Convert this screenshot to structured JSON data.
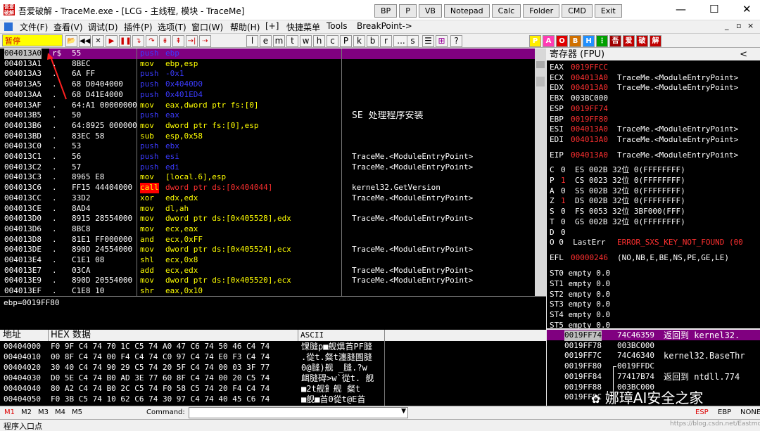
{
  "window": {
    "title": "吾爱破解 - TraceMe.exe - [LCG - 主线程, 模块 - TraceMe]",
    "icon_text": "吾爱破解",
    "quick_buttons": [
      "BP",
      "P",
      "VB",
      "Notepad",
      "Calc",
      "Folder",
      "CMD",
      "Exit"
    ]
  },
  "menu": [
    "文件(F)",
    "查看(V)",
    "调试(D)",
    "插件(P)",
    "选项(T)",
    "窗口(W)",
    "帮助(H)",
    "[+]",
    "快捷菜单",
    "Tools",
    "BreakPoint->"
  ],
  "toolbar": {
    "status": "暂停",
    "letters": [
      "l",
      "e",
      "m",
      "t",
      "w",
      "h",
      "c",
      "P",
      "k",
      "b",
      "r",
      "...",
      "s"
    ],
    "right_icons": [
      "P",
      "A",
      "O",
      "B",
      "H",
      "⋮",
      "吾",
      "爱",
      "破",
      "解"
    ]
  },
  "disasm": [
    {
      "addr": "004013A0",
      "mark": "r$",
      "hex": "55",
      "op": "push",
      "args": "ebp",
      "cmt": ""
    },
    {
      "addr": "004013A1",
      "mark": ".",
      "hex": "8BEC",
      "op": "mov",
      "args": "ebp,esp",
      "cmt": ""
    },
    {
      "addr": "004013A3",
      "mark": ".",
      "hex": "6A FF",
      "op": "push",
      "args": "-0x1",
      "cmt": ""
    },
    {
      "addr": "004013A5",
      "mark": ".",
      "hex": "68 D0404000",
      "op": "push",
      "args": "0x4040D0",
      "cmt": ""
    },
    {
      "addr": "004013AA",
      "mark": ".",
      "hex": "68 D41E4000",
      "op": "push",
      "args": "0x401ED4",
      "cmt": "SE 处理程序安装"
    },
    {
      "addr": "004013AF",
      "mark": ".",
      "hex": "64:A1 00000000",
      "op": "mov",
      "args": "eax,dword ptr fs:[0]",
      "cmt": ""
    },
    {
      "addr": "004013B5",
      "mark": ".",
      "hex": "50",
      "op": "push",
      "args": "eax",
      "cmt": ""
    },
    {
      "addr": "004013B6",
      "mark": ".",
      "hex": "64:8925 00000000",
      "op": "mov",
      "args": "dword ptr fs:[0],esp",
      "cmt": ""
    },
    {
      "addr": "004013BD",
      "mark": ".",
      "hex": "83EC 58",
      "op": "sub",
      "args": "esp,0x58",
      "cmt": ""
    },
    {
      "addr": "004013C0",
      "mark": ".",
      "hex": "53",
      "op": "push",
      "args": "ebx",
      "cmt": ""
    },
    {
      "addr": "004013C1",
      "mark": ".",
      "hex": "56",
      "op": "push",
      "args": "esi",
      "cmt": "TraceMe.<ModuleEntryPoint>"
    },
    {
      "addr": "004013C2",
      "mark": ".",
      "hex": "57",
      "op": "push",
      "args": "edi",
      "cmt": "TraceMe.<ModuleEntryPoint>"
    },
    {
      "addr": "004013C3",
      "mark": ".",
      "hex": "8965 E8",
      "op": "mov",
      "args": "[local.6],esp",
      "cmt": ""
    },
    {
      "addr": "004013C6",
      "mark": ".",
      "hex": "FF15 44404000",
      "op": "call",
      "args": "dword ptr ds:[0x404044]",
      "cmt": "kernel32.GetVersion"
    },
    {
      "addr": "004013CC",
      "mark": ".",
      "hex": "33D2",
      "op": "xor",
      "args": "edx,edx",
      "cmt": "TraceMe.<ModuleEntryPoint>"
    },
    {
      "addr": "004013CE",
      "mark": ".",
      "hex": "8AD4",
      "op": "mov",
      "args": "dl,ah",
      "cmt": ""
    },
    {
      "addr": "004013D0",
      "mark": ".",
      "hex": "8915 28554000",
      "op": "mov",
      "args": "dword ptr ds:[0x405528],edx",
      "cmt": "TraceMe.<ModuleEntryPoint>"
    },
    {
      "addr": "004013D6",
      "mark": ".",
      "hex": "8BC8",
      "op": "mov",
      "args": "ecx,eax",
      "cmt": ""
    },
    {
      "addr": "004013D8",
      "mark": ".",
      "hex": "81E1 FF000000",
      "op": "and",
      "args": "ecx,0xFF",
      "cmt": ""
    },
    {
      "addr": "004013DE",
      "mark": ".",
      "hex": "890D 24554000",
      "op": "mov",
      "args": "dword ptr ds:[0x405524],ecx",
      "cmt": "TraceMe.<ModuleEntryPoint>"
    },
    {
      "addr": "004013E4",
      "mark": ".",
      "hex": "C1E1 08",
      "op": "shl",
      "args": "ecx,0x8",
      "cmt": ""
    },
    {
      "addr": "004013E7",
      "mark": ".",
      "hex": "03CA",
      "op": "add",
      "args": "ecx,edx",
      "cmt": "TraceMe.<ModuleEntryPoint>"
    },
    {
      "addr": "004013E9",
      "mark": ".",
      "hex": "890D 20554000",
      "op": "mov",
      "args": "dword ptr ds:[0x405520],ecx",
      "cmt": "TraceMe.<ModuleEntryPoint>"
    },
    {
      "addr": "004013EF",
      "mark": ".",
      "hex": "C1E8 10",
      "op": "shr",
      "args": "eax,0x10",
      "cmt": ""
    }
  ],
  "info": "ebp=0019FF80",
  "registers": {
    "header": "寄存器 (FPU)",
    "gp": [
      {
        "name": "EAX",
        "val": "0019FFCC",
        "note": ""
      },
      {
        "name": "ECX",
        "val": "004013A0",
        "note": "TraceMe.<ModuleEntryPoint>"
      },
      {
        "name": "EDX",
        "val": "004013A0",
        "note": "TraceMe.<ModuleEntryPoint>"
      },
      {
        "name": "EBX",
        "val": "003BC000",
        "note": ""
      },
      {
        "name": "ESP",
        "val": "0019FF74",
        "note": ""
      },
      {
        "name": "EBP",
        "val": "0019FF80",
        "note": ""
      },
      {
        "name": "ESI",
        "val": "004013A0",
        "note": "TraceMe.<ModuleEntryPoint>"
      },
      {
        "name": "EDI",
        "val": "004013A0",
        "note": "TraceMe.<ModuleEntryPoint>"
      }
    ],
    "eip": {
      "name": "EIP",
      "val": "004013A0",
      "note": "TraceMe.<ModuleEntryPoint>"
    },
    "flags": [
      {
        "f": "C",
        "v": "0",
        "seg": "ES 002B 32位 0(FFFFFFFF)"
      },
      {
        "f": "P",
        "v": "1",
        "seg": "CS 0023 32位 0(FFFFFFFF)"
      },
      {
        "f": "A",
        "v": "0",
        "seg": "SS 002B 32位 0(FFFFFFFF)"
      },
      {
        "f": "Z",
        "v": "1",
        "seg": "DS 002B 32位 0(FFFFFFFF)"
      },
      {
        "f": "S",
        "v": "0",
        "seg": "FS 0053 32位 3BF000(FFF)"
      },
      {
        "f": "T",
        "v": "0",
        "seg": "GS 002B 32位 0(FFFFFFFF)"
      },
      {
        "f": "D",
        "v": "0",
        "seg": ""
      }
    ],
    "lasterr_label": "O 0  LastErr",
    "lasterr": "ERROR_SXS_KEY_NOT_FOUND (00",
    "efl_label": "EFL",
    "efl": "00000246",
    "efl_note": "(NO,NB,E,BE,NS,PE,GE,LE)",
    "fpu": [
      "ST0 empty 0.0",
      "ST1 empty 0.0",
      "ST2 empty 0.0",
      "ST3 empty 0.0",
      "ST4 empty 0.0",
      "ST5 empty 0.0"
    ]
  },
  "dump": {
    "col_addr": "地址",
    "col_hex": "HEX 数据",
    "col_ascii": "ASCII",
    "rows": [
      {
        "addr": "00404000",
        "hex": "F0 9F C4 74 70 1C C5 74 A0 47 C6 74 50 46 C4 74",
        "ascii": "馃膖p■舰熼苩PF膖"
      },
      {
        "addr": "00404010",
        "hex": "00 8F C4 74 00 F4 C4 74 C0 97 C4 74 E0 F3 C4 74",
        "ascii": ".從t.粲t瀍膖圄膖"
      },
      {
        "addr": "00404020",
        "hex": "30 40 C4 74 90 29 C5 74 20 5F C4 74 00 03 3F 77",
        "ascii": "0@膖)舰 _膖.?w"
      },
      {
        "addr": "00404030",
        "hex": "D0 5E C4 74 B0 AD 3E 77 60 8F C4 74 00 20 C5 74",
        "ascii": "衈膖碍>w`從t. 舰"
      },
      {
        "addr": "00404040",
        "hex": "80 A2 C4 74 B0 2C C5 74 F0 58 C5 74 20 F4 C4 74",
        "ascii": "■2t舰飠舰 粲t"
      },
      {
        "addr": "00404050",
        "hex": "F0 3B C5 74 10 62 C6 74 30 97 C4 74 40 45 C6 74",
        "ascii": "■舰■苩0從t@E苩"
      }
    ]
  },
  "stack": [
    {
      "addr": "0019FF74",
      "val": "74C46359",
      "note": "返回到 kernel32."
    },
    {
      "addr": "0019FF78",
      "val": "003BC000",
      "note": ""
    },
    {
      "addr": "0019FF7C",
      "val": "74C46340",
      "note": "kernel32.BaseThr"
    },
    {
      "addr": "0019FF80",
      "val": "0019FFDC",
      "note": ""
    },
    {
      "addr": "0019FF84",
      "val": "77417B74",
      "note": "返回到 ntdll.774"
    },
    {
      "addr": "0019FF88",
      "val": "003BC000",
      "note": ""
    },
    {
      "addr": "0019FF8C",
      "val": "",
      "note": ""
    }
  ],
  "commandbar": {
    "tabs": [
      "M1",
      "M2",
      "M3",
      "M4",
      "M5"
    ],
    "label": "Command:",
    "right": [
      "ESP",
      "EBP",
      "NONE"
    ]
  },
  "status": "程序入口点",
  "watermark": {
    "brand": "娜璋AI安全之家",
    "url": "https://blog.csdn.net/Eastmount"
  }
}
